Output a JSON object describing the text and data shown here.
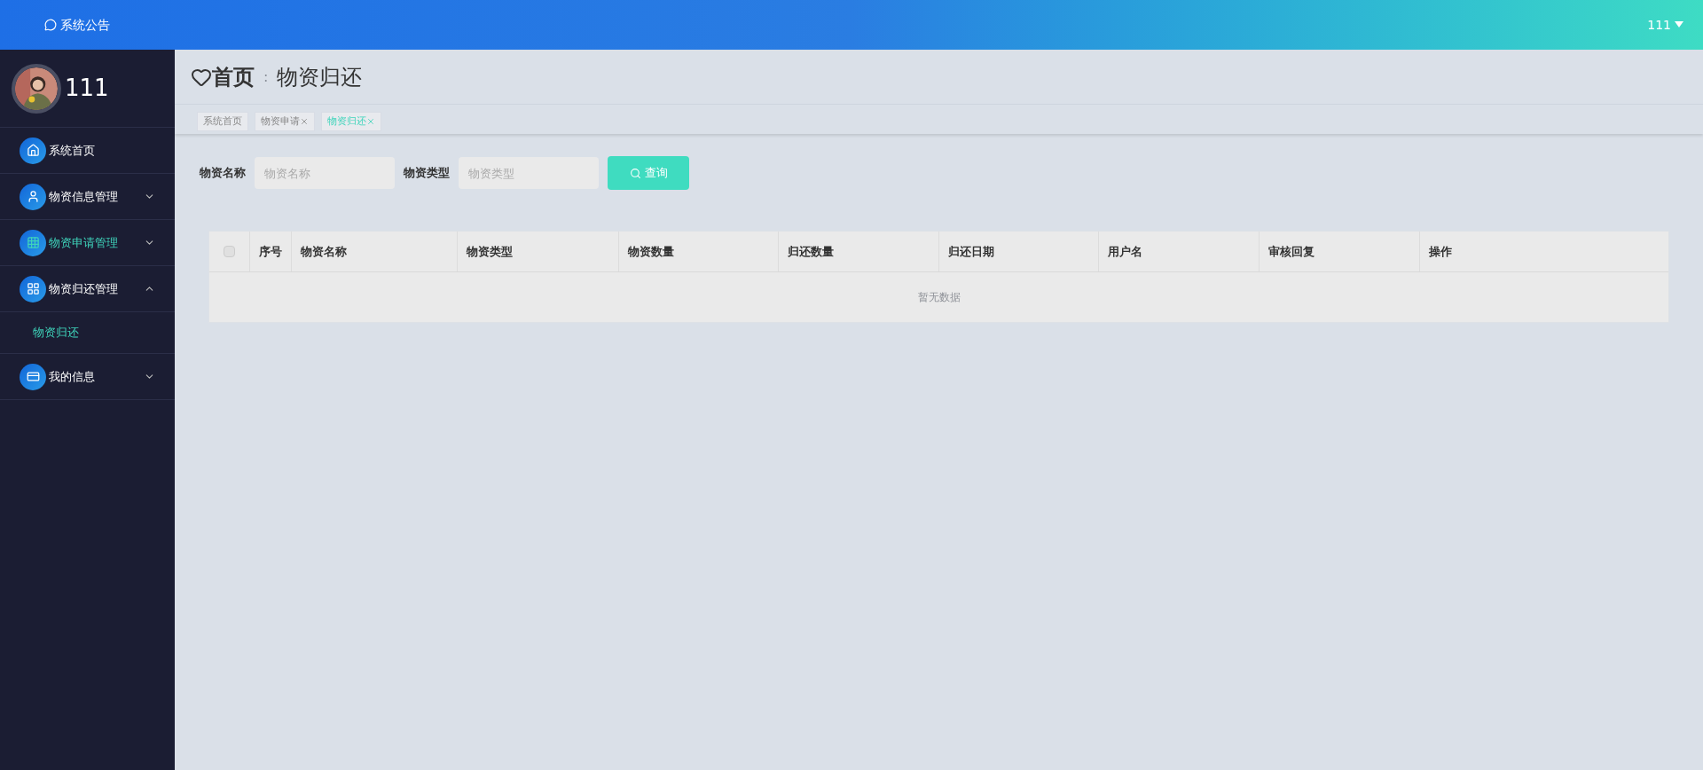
{
  "top_bar": {
    "notice": "系统公告",
    "user": "111"
  },
  "sidebar": {
    "user_name": "111",
    "items": [
      {
        "kind": "home",
        "label": "系统首页",
        "active": false
      },
      {
        "kind": "user",
        "label": "物资信息管理",
        "active": false,
        "expanded": false
      },
      {
        "kind": "grid",
        "label": "物资申请管理",
        "active": true,
        "expanded": false
      },
      {
        "kind": "apps",
        "label": "物资归还管理",
        "active": false,
        "expanded": true,
        "children": [
          {
            "label": "物资归还",
            "selected": true
          }
        ]
      },
      {
        "kind": "card",
        "label": "我的信息",
        "active": false,
        "expanded": false
      }
    ]
  },
  "breadcrumb": {
    "home": "首页",
    "separator": ":",
    "current": "物资归还"
  },
  "tabs": [
    {
      "label": "系统首页",
      "selected": false,
      "closable": false
    },
    {
      "label": "物资申请",
      "selected": false,
      "closable": true
    },
    {
      "label": "物资归还",
      "selected": true,
      "closable": true
    }
  ],
  "search": {
    "fields": [
      {
        "label": "物资名称",
        "placeholder": "物资名称"
      },
      {
        "label": "物资类型",
        "placeholder": "物资类型"
      }
    ],
    "button": "查询"
  },
  "table": {
    "select_all_checked": false,
    "columns": [
      "序号",
      "物资名称",
      "物资类型",
      "物资数量",
      "归还数量",
      "归还日期",
      "用户名",
      "审核回复",
      "操作"
    ],
    "empty_text": "暂无数据"
  }
}
